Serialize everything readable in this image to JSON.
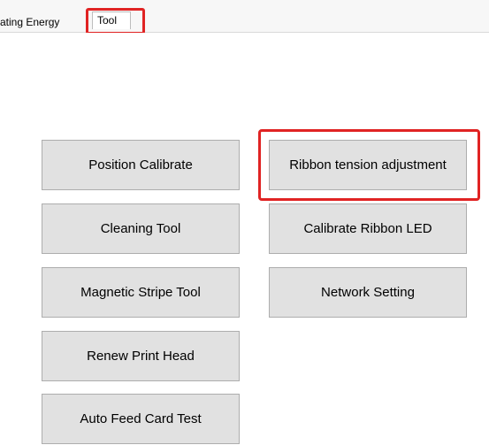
{
  "tabs": {
    "previous_label": "ating Energy",
    "active_label": "Tool"
  },
  "tool_panel": {
    "left_column": [
      "Position Calibrate",
      "Cleaning Tool",
      "Magnetic Stripe Tool",
      "Renew Print Head",
      "Auto Feed Card Test"
    ],
    "right_column": [
      "Ribbon tension adjustment",
      "Calibrate Ribbon LED",
      "Network Setting"
    ]
  },
  "colors": {
    "highlight": "#e02323",
    "button_face": "#e1e1e1",
    "button_border": "#adadad"
  }
}
